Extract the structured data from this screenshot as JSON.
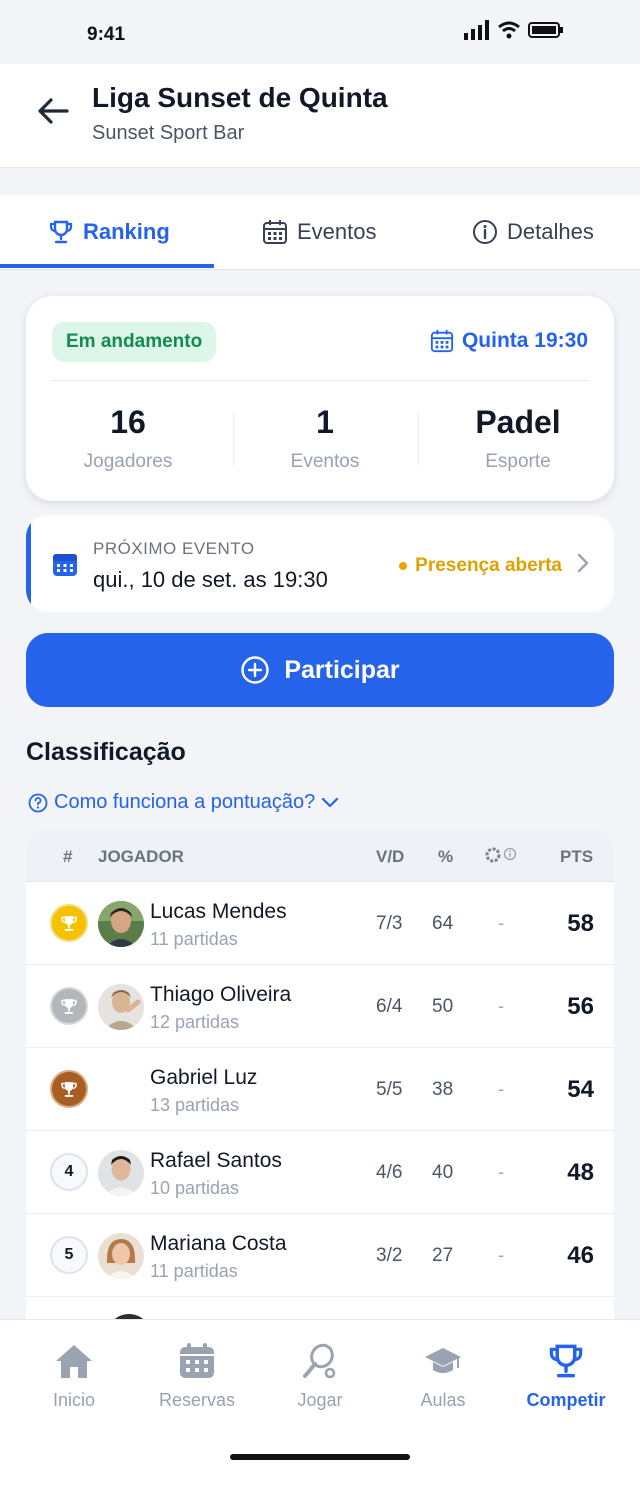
{
  "status_bar": {
    "time": "9:41"
  },
  "header": {
    "title": "Liga Sunset de Quinta",
    "subtitle": "Sunset Sport Bar"
  },
  "tabs": [
    {
      "label": "Ranking",
      "icon": "trophy-icon",
      "active": true
    },
    {
      "label": "Eventos",
      "icon": "calendar-icon",
      "active": false
    },
    {
      "label": "Detalhes",
      "icon": "info-icon",
      "active": false
    }
  ],
  "summary": {
    "status": "Em andamento",
    "schedule": "Quinta 19:30",
    "stats": [
      {
        "value": "16",
        "label": "Jogadores"
      },
      {
        "value": "1",
        "label": "Eventos"
      },
      {
        "value": "Padel",
        "label": "Esporte"
      }
    ]
  },
  "next_event": {
    "label": "PRÓXIMO EVENTO",
    "date": "qui., 10 de set. as 19:30",
    "presence": "Presença aberta"
  },
  "join_button": {
    "label": "Participar"
  },
  "standings": {
    "title": "Classificação",
    "help_link": "Como funciona a pontuação?",
    "columns": {
      "rank": "#",
      "player": "JOGADOR",
      "wl": "V/D",
      "pct": "%",
      "pts": "PTS"
    },
    "rows": [
      {
        "rank": "1",
        "medal": "gold",
        "name": "Lucas Mendes",
        "matches": "11 partidas",
        "wl": "7/3",
        "pct": "64",
        "bonus": "-",
        "pts": "58",
        "avatar": true
      },
      {
        "rank": "2",
        "medal": "silver",
        "name": "Thiago Oliveira",
        "matches": "12 partidas",
        "wl": "6/4",
        "pct": "50",
        "bonus": "-",
        "pts": "56",
        "avatar": true
      },
      {
        "rank": "3",
        "medal": "bronze",
        "name": "Gabriel Luz",
        "matches": "13 partidas",
        "wl": "5/5",
        "pct": "38",
        "bonus": "-",
        "pts": "54",
        "avatar": false
      },
      {
        "rank": "4",
        "medal": "",
        "name": "Rafael Santos",
        "matches": "10 partidas",
        "wl": "4/6",
        "pct": "40",
        "bonus": "-",
        "pts": "48",
        "avatar": true
      },
      {
        "rank": "5",
        "medal": "",
        "name": "Mariana Costa",
        "matches": "11 partidas",
        "wl": "3/2",
        "pct": "27",
        "bonus": "-",
        "pts": "46",
        "avatar": true
      }
    ]
  },
  "bottom_nav": [
    {
      "label": "Inicio",
      "icon": "home-icon",
      "active": false
    },
    {
      "label": "Reservas",
      "icon": "calendar-icon",
      "active": false
    },
    {
      "label": "Jogar",
      "icon": "racket-icon",
      "active": false
    },
    {
      "label": "Aulas",
      "icon": "graduation-cap-icon",
      "active": false
    },
    {
      "label": "Competir",
      "icon": "trophy-icon",
      "active": true
    }
  ],
  "colors": {
    "accent": "#2563eb",
    "success_bg": "#dcf7e9",
    "success_text": "#138a4f",
    "warning": "#e0a100"
  }
}
